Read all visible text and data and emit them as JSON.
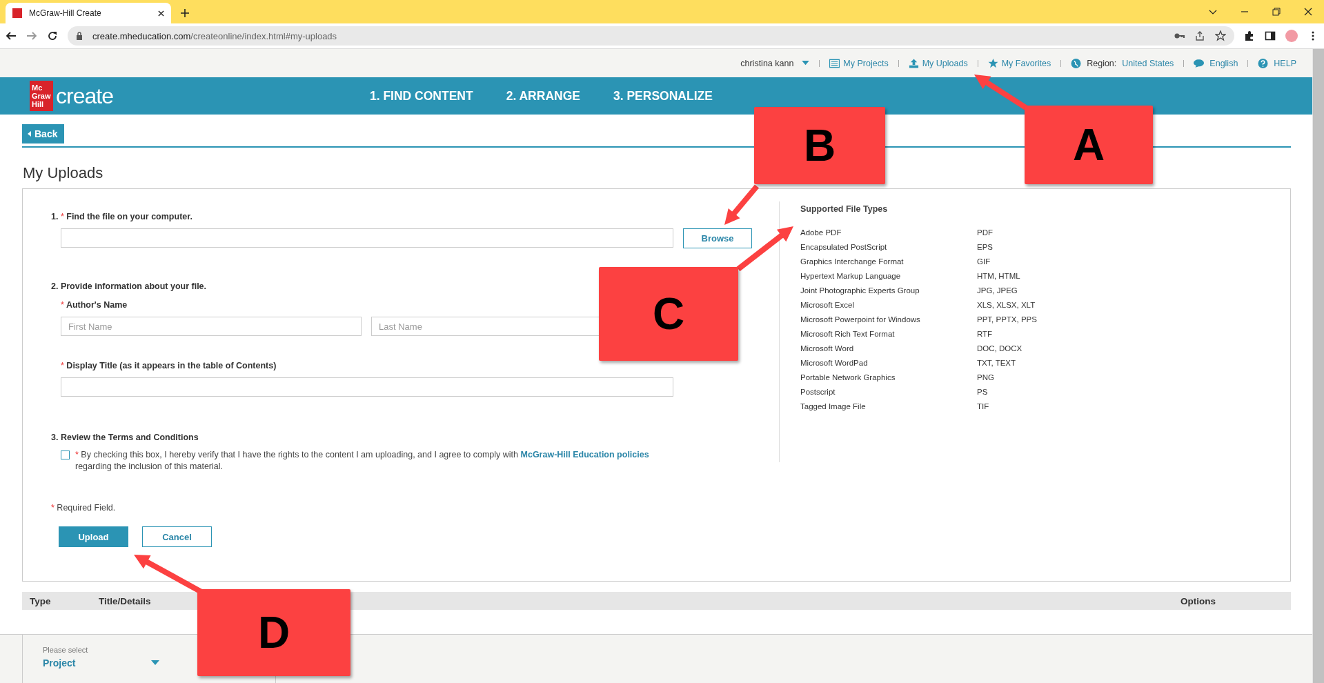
{
  "browser": {
    "tab_title": "McGraw-Hill Create",
    "url_host": "create.mheducation.com",
    "url_path": "/createonline/index.html#my-uploads"
  },
  "user_bar": {
    "user": "christina kann",
    "links": [
      {
        "label": "My Projects",
        "kind": "projects"
      },
      {
        "label": "My Uploads",
        "kind": "uploads"
      },
      {
        "label": "My Favorites",
        "kind": "favorites"
      }
    ],
    "region_label": "Region:",
    "region": "United States",
    "language": "English",
    "help": "HELP"
  },
  "header": {
    "logo_lines": [
      "Mc",
      "Graw",
      "Hill"
    ],
    "logo_word": "create",
    "nav": [
      {
        "label": "1. FIND CONTENT"
      },
      {
        "label": "2. ARRANGE"
      },
      {
        "label": "3. PERSONALIZE"
      }
    ]
  },
  "back": "Back",
  "title": "My Uploads",
  "form": {
    "required_mark": "*",
    "step1": {
      "num": "1.",
      "label": "Find the file on your computer.",
      "browse": "Browse"
    },
    "step2": {
      "label": "2. Provide information about your file.",
      "author_label": "Author's Name",
      "first_placeholder": "First Name",
      "last_placeholder": "Last Name",
      "title_label": "Display Title (as it appears in the table of Contents)"
    },
    "step3": {
      "label": "3. Review the Terms and Conditions",
      "checked": false,
      "text": "By checking this box, I hereby verify that I have the rights to the content I am uploading, and I agree to comply with",
      "link": "McGraw-Hill Education policies",
      "text2": "regarding the inclusion of this material."
    },
    "required": "Required Field.",
    "upload": "Upload",
    "cancel": "Cancel"
  },
  "file_types": {
    "title": "Supported File Types",
    "rows": [
      {
        "name": "Adobe PDF",
        "ext": "PDF"
      },
      {
        "name": "Encapsulated PostScript",
        "ext": "EPS"
      },
      {
        "name": "Graphics Interchange Format",
        "ext": "GIF"
      },
      {
        "name": "Hypertext Markup Language",
        "ext": "HTM, HTML"
      },
      {
        "name": "Joint Photographic Experts Group",
        "ext": "JPG, JPEG"
      },
      {
        "name": "Microsoft Excel",
        "ext": "XLS, XLSX, XLT"
      },
      {
        "name": "Microsoft Powerpoint for Windows",
        "ext": "PPT, PPTX, PPS"
      },
      {
        "name": "Microsoft Rich Text Format",
        "ext": "RTF"
      },
      {
        "name": "Microsoft Word",
        "ext": "DOC, DOCX"
      },
      {
        "name": "Microsoft WordPad",
        "ext": "TXT, TEXT"
      },
      {
        "name": "Portable Network Graphics",
        "ext": "PNG"
      },
      {
        "name": "Postscript",
        "ext": "PS"
      },
      {
        "name": "Tagged Image File",
        "ext": "TIF"
      }
    ]
  },
  "table": {
    "columns": [
      "Type",
      "Title/Details",
      "Options"
    ]
  },
  "project_select": {
    "hint": "Please select",
    "value": "Project"
  },
  "callouts": [
    {
      "label": "A"
    },
    {
      "label": "B"
    },
    {
      "label": "C"
    },
    {
      "label": "D"
    }
  ]
}
